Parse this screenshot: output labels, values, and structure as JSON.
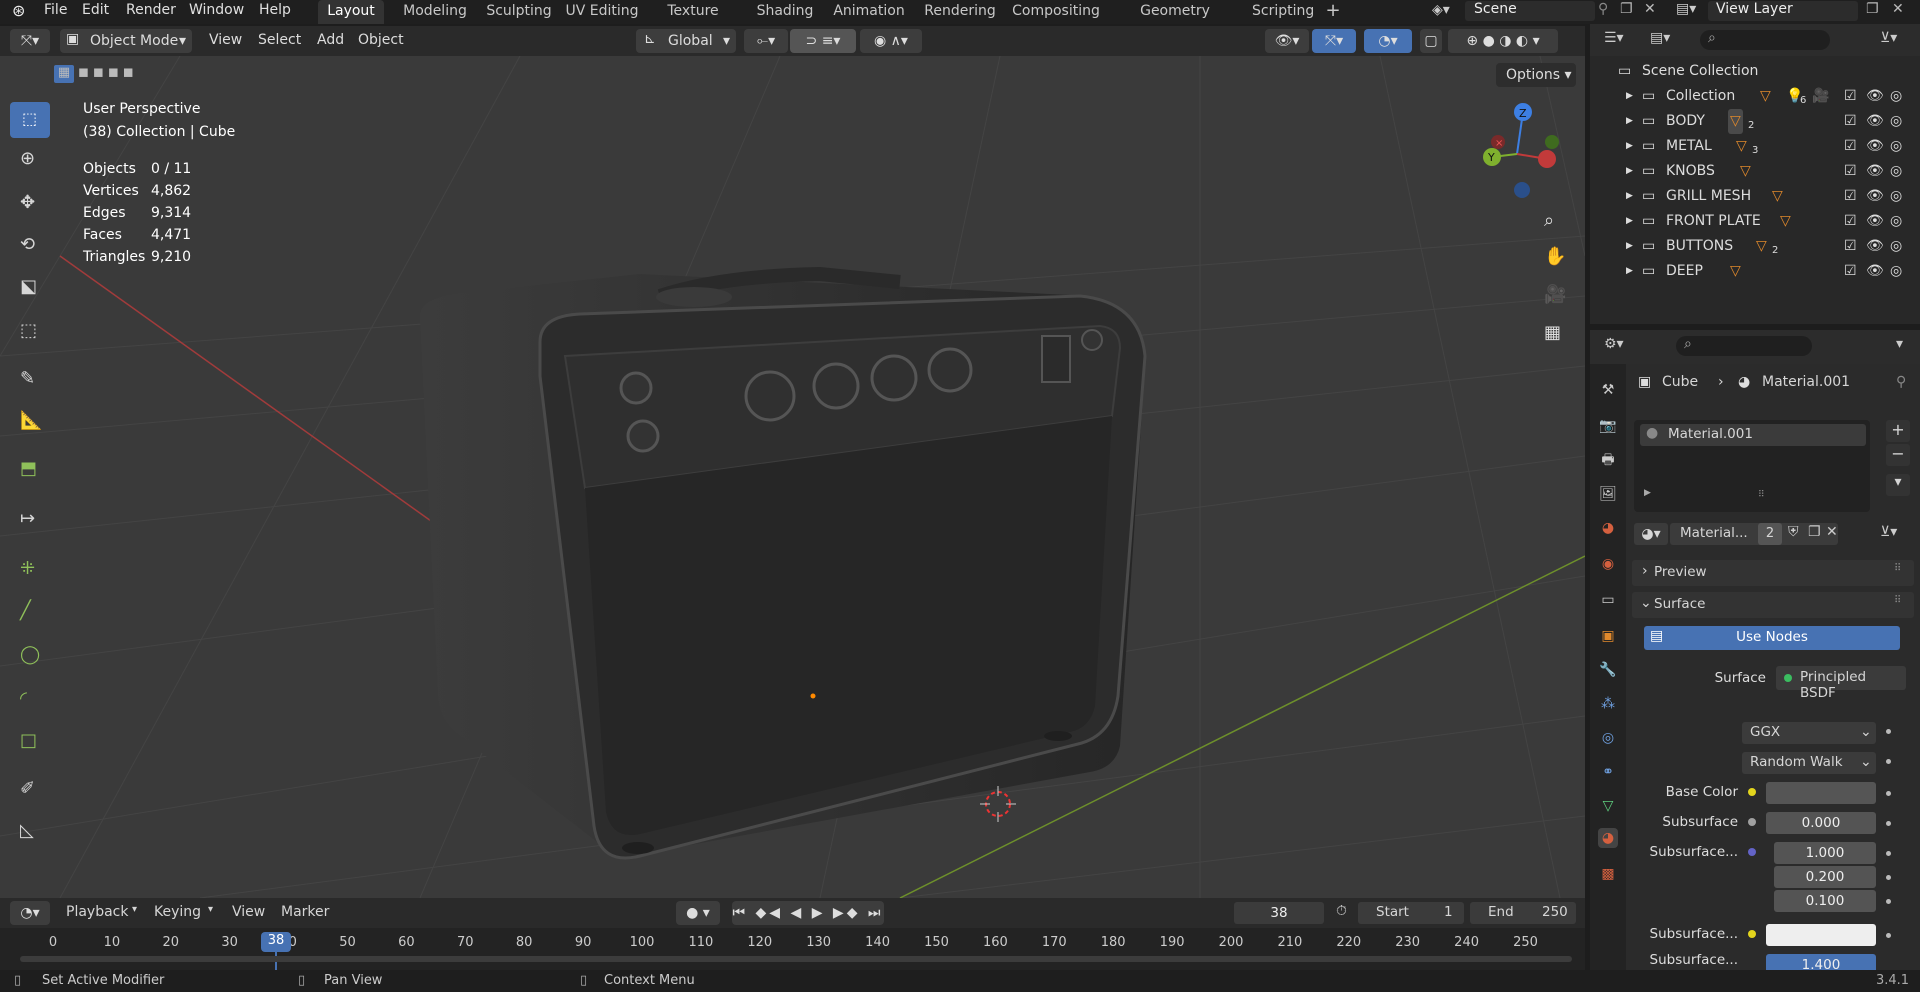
{
  "menu": [
    "File",
    "Edit",
    "Render",
    "Window",
    "Help"
  ],
  "workspaces": [
    "Layout",
    "Modeling",
    "Sculpting",
    "UV Editing",
    "Texture Paint",
    "Shading",
    "Animation",
    "Rendering",
    "Compositing",
    "Geometry Nodes",
    "Scripting"
  ],
  "scene": "Scene",
  "view_layer": "View Layer",
  "header": {
    "mode": "Object Mode",
    "menus": [
      "View",
      "Select",
      "Add",
      "Object"
    ],
    "transform_orientation": "Global",
    "options": "Options"
  },
  "overlay": {
    "view_name": "User Perspective",
    "context": "(38) Collection | Cube",
    "stats": [
      {
        "label": "Objects",
        "value": "0 / 11"
      },
      {
        "label": "Vertices",
        "value": "4,862"
      },
      {
        "label": "Edges",
        "value": "9,314"
      },
      {
        "label": "Faces",
        "value": "4,471"
      },
      {
        "label": "Triangles",
        "value": "9,210"
      }
    ]
  },
  "gizmo": {
    "z": "Z",
    "y": "Y",
    "x": "X"
  },
  "outliner": {
    "root": "Scene Collection",
    "items": [
      {
        "name": "Collection",
        "badge": "6"
      },
      {
        "name": "BODY",
        "badge": "2"
      },
      {
        "name": "METAL",
        "badge": "3"
      },
      {
        "name": "KNOBS",
        "badge": ""
      },
      {
        "name": "GRILL MESH",
        "badge": ""
      },
      {
        "name": "FRONT PLATE",
        "badge": ""
      },
      {
        "name": "BUTTONS",
        "badge": "2"
      },
      {
        "name": "DEEP",
        "badge": ""
      }
    ]
  },
  "properties": {
    "breadcrumb_object": "Cube",
    "breadcrumb_material": "Material.001",
    "slot_name": "Material.001",
    "material_name": "Material...",
    "users": "2",
    "panel_preview": "Preview",
    "panel_surface": "Surface",
    "use_nodes": "Use Nodes",
    "surface_label": "Surface",
    "surface_value": "Principled BSDF",
    "distribution": "GGX",
    "subsurface_method": "Random Walk",
    "base_color_label": "Base Color",
    "subsurface_label": "Subsurface",
    "subsurface_value": "0.000",
    "subsurface_radius_label": "Subsurface...",
    "radius": [
      "1.000",
      "0.200",
      "0.100"
    ],
    "subsurface_color_label": "Subsurface...",
    "subsurface_ior_label": "Subsurface...",
    "subsurface_ior_value": "1.400"
  },
  "timeline": {
    "menus": [
      "Playback",
      "Keying",
      "View",
      "Marker"
    ],
    "current_frame": "38",
    "start_label": "Start",
    "start": "1",
    "end_label": "End",
    "end": "250",
    "ticks": [
      "0",
      "10",
      "20",
      "30",
      "40",
      "50",
      "60",
      "70",
      "80",
      "90",
      "100",
      "110",
      "120",
      "130",
      "140",
      "150",
      "160",
      "170",
      "180",
      "190",
      "200",
      "210",
      "220",
      "230",
      "240",
      "250"
    ]
  },
  "status": {
    "left": "Set Active Modifier",
    "middle": "Pan View",
    "right": "Context Menu",
    "version": "3.4.1"
  },
  "colors": {
    "accent": "#4772b3",
    "collection_icon": "#e0892c"
  }
}
